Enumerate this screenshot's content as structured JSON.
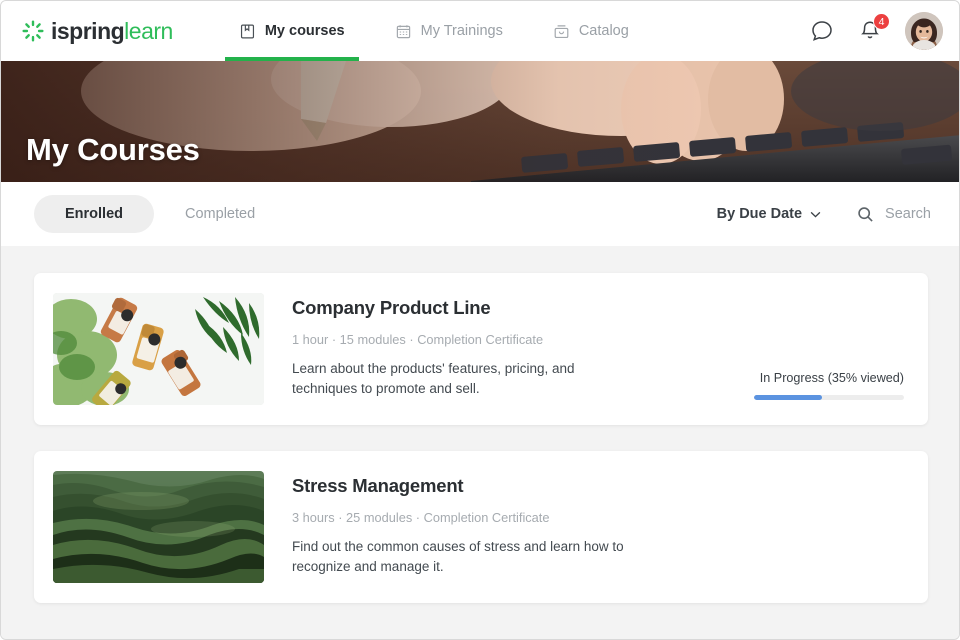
{
  "header": {
    "logo": {
      "mark": "ispring-starburst-icon",
      "name": "ispring",
      "product": "learn"
    },
    "nav": [
      {
        "label": "My courses",
        "icon": "book-icon",
        "active": true
      },
      {
        "label": "My Trainings",
        "icon": "calendar-icon",
        "active": false
      },
      {
        "label": "Catalog",
        "icon": "briefcase-icon",
        "active": false
      }
    ],
    "chat_icon": "chat-bubble-icon",
    "bell_icon": "bell-icon",
    "notification_count": "4",
    "avatar_alt": "user-avatar"
  },
  "hero": {
    "title": "My Courses"
  },
  "filters": {
    "tabs": [
      {
        "label": "Enrolled",
        "active": true
      },
      {
        "label": "Completed",
        "active": false
      }
    ],
    "sort": {
      "label": "By Due Date",
      "icon": "chevron-down-icon"
    },
    "search": {
      "placeholder": "Search",
      "icon": "search-icon"
    }
  },
  "courses": [
    {
      "title": "Company Product Line",
      "meta": "1 hour · 15 modules  ·  Completion Certificate",
      "description": "Learn about the products' features, pricing, and techniques to promote and sell.",
      "progress_label": "In Progress (35% viewed)",
      "progress_percent": 45,
      "thumb": "product-bottles-photo"
    },
    {
      "title": "Stress Management",
      "meta": "3 hours · 25 modules  ·  Completion Certificate",
      "description": "Find out the common causes of stress and learn how to recognize and manage it.",
      "progress_label": "",
      "progress_percent": 0,
      "thumb": "green-hills-photo"
    }
  ],
  "colors": {
    "brand_green": "#2fbd5a",
    "active_underline": "#23b24b",
    "badge_red": "#ec4040",
    "progress_blue": "#5b93e0",
    "page_bg": "#f3f3f3"
  }
}
